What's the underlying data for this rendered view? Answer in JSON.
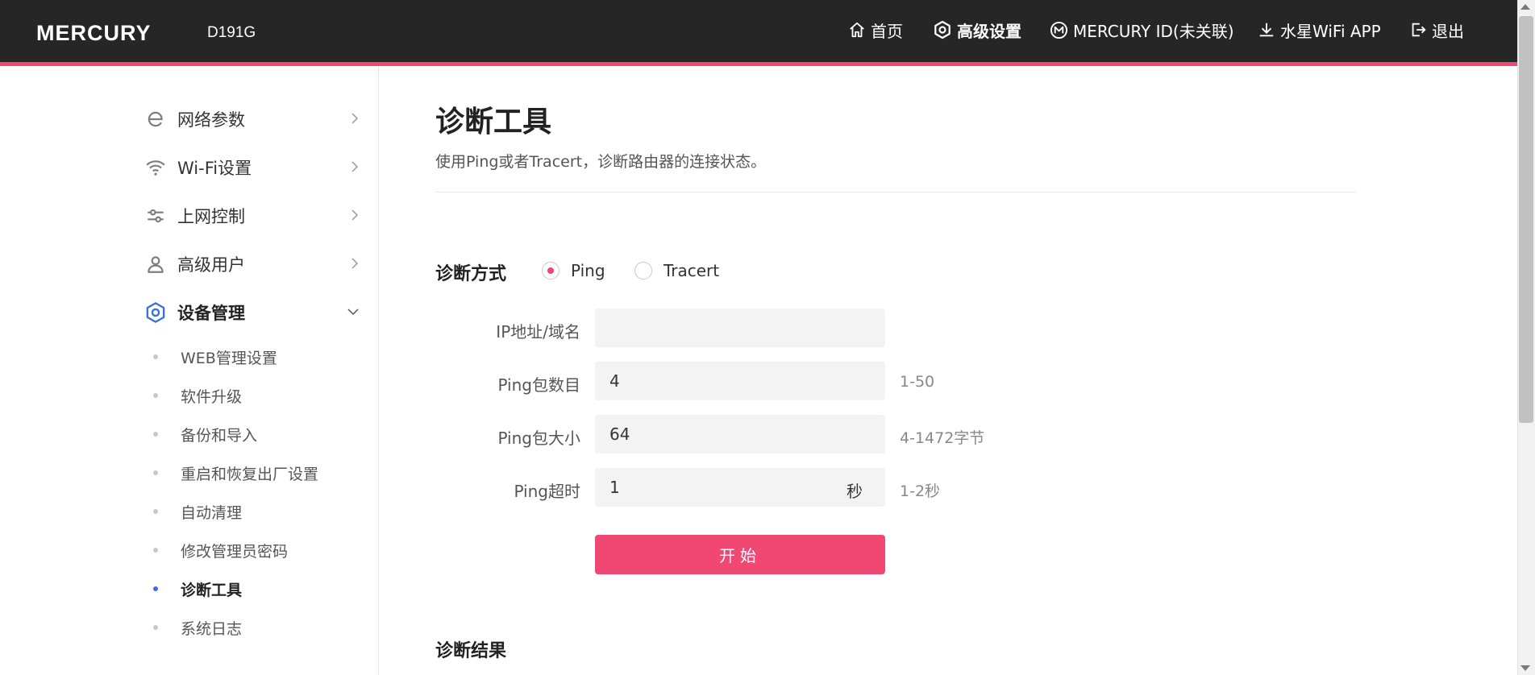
{
  "header": {
    "brand": "MERCURY",
    "model": "D191G",
    "nav": [
      {
        "label": "首页",
        "icon": "home-icon"
      },
      {
        "label": "高级设置",
        "icon": "gear-icon"
      },
      {
        "label": "MERCURY ID(未关联)",
        "icon": "mercury-id-icon"
      },
      {
        "label": "水星WiFi APP",
        "icon": "download-icon"
      },
      {
        "label": "退出",
        "icon": "logout-icon"
      }
    ],
    "active_nav": "高级设置"
  },
  "colors": {
    "accent": "#f0466f",
    "header_bg": "#262626",
    "active_dot": "#3b6fd9"
  },
  "sidebar": {
    "items": [
      {
        "label": "网络参数",
        "icon": "ie-network-icon"
      },
      {
        "label": "Wi-Fi设置",
        "icon": "wifi-icon"
      },
      {
        "label": "上网控制",
        "icon": "sliders-icon"
      },
      {
        "label": "高级用户",
        "icon": "user-icon"
      },
      {
        "label": "设备管理",
        "icon": "gear-icon",
        "expanded": true
      }
    ],
    "subitems": [
      {
        "label": "WEB管理设置"
      },
      {
        "label": "软件升级"
      },
      {
        "label": "备份和导入"
      },
      {
        "label": "重启和恢复出厂设置"
      },
      {
        "label": "自动清理"
      },
      {
        "label": "修改管理员密码"
      },
      {
        "label": "诊断工具",
        "active": true
      },
      {
        "label": "系统日志"
      }
    ]
  },
  "main": {
    "title": "诊断工具",
    "description": "使用Ping或者Tracert，诊断路由器的连接状态。",
    "method": {
      "label": "诊断方式",
      "options": [
        "Ping",
        "Tracert"
      ],
      "selected": "Ping"
    },
    "fields": {
      "ip": {
        "label": "IP地址/域名",
        "value": "",
        "placeholder": ""
      },
      "count": {
        "label": "Ping包数目",
        "value": "4",
        "hint": "1-50"
      },
      "size": {
        "label": "Ping包大小",
        "value": "64",
        "hint": "4-1472字节"
      },
      "timeout": {
        "label": "Ping超时",
        "value": "1",
        "unit": "秒",
        "hint": "1-2秒"
      }
    },
    "start_button": "开始",
    "result_label": "诊断结果"
  }
}
